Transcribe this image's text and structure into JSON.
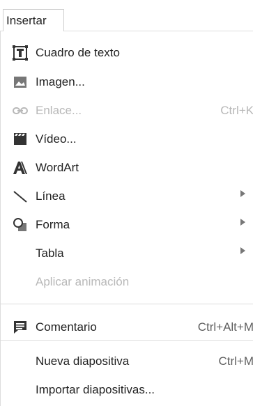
{
  "menubar": {
    "active_tab": "Insertar"
  },
  "menu": {
    "items": [
      {
        "label": "Cuadro de texto",
        "icon": "text-box-icon",
        "enabled": true
      },
      {
        "label": "Imagen...",
        "icon": "image-icon",
        "enabled": true
      },
      {
        "label": "Enlace...",
        "shortcut": "Ctrl+K",
        "icon": "link-icon",
        "enabled": false
      },
      {
        "label": "Vídeo...",
        "icon": "video-icon",
        "enabled": true
      },
      {
        "label": "WordArt",
        "icon": "wordart-icon",
        "enabled": true
      },
      {
        "label": "Línea",
        "icon": "line-icon",
        "enabled": true,
        "has_submenu": true
      },
      {
        "label": "Forma",
        "icon": "shape-icon",
        "enabled": true,
        "has_submenu": true
      },
      {
        "label": "Tabla",
        "enabled": true,
        "has_submenu": true
      },
      {
        "label": "Aplicar animación",
        "enabled": false
      },
      {
        "label": "Comentario",
        "shortcut": "Ctrl+Alt+M",
        "icon": "comment-icon",
        "enabled": true
      },
      {
        "label": "Nueva diapositiva",
        "shortcut": "Ctrl+M",
        "enabled": true
      },
      {
        "label": "Importar diapositivas...",
        "enabled": true
      }
    ]
  },
  "colors": {
    "text": "#222222",
    "disabled_text": "#b8b8b8",
    "shortcut_text": "#5f5f5f",
    "separator": "#dcdcdc",
    "icon": "#333333",
    "icon_gray": "#777777"
  }
}
